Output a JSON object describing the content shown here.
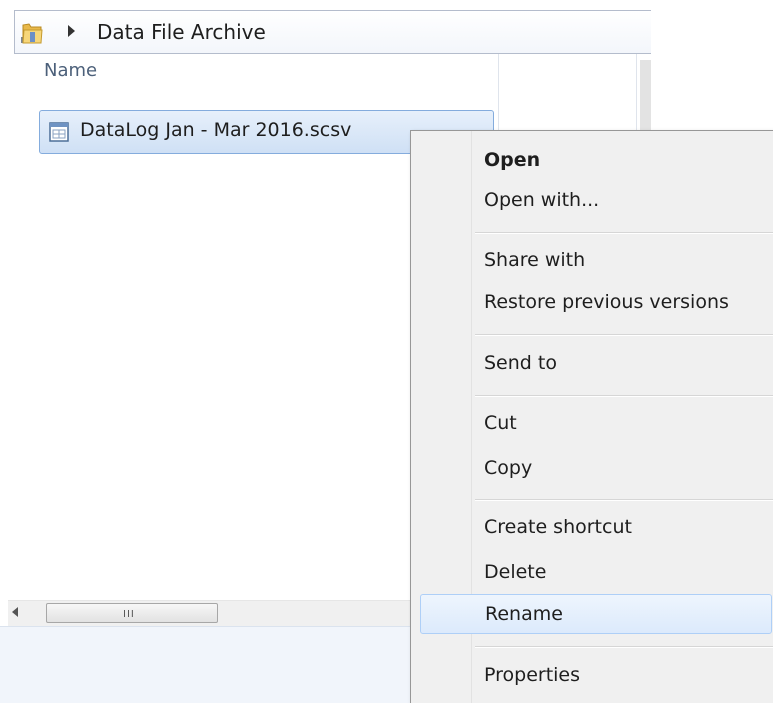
{
  "address_bar": {
    "location": "Data File Archive"
  },
  "column_headers": {
    "name": "Name"
  },
  "files": [
    {
      "name": "DataLog Jan - Mar 2016.scsv",
      "icon": "spreadsheet-file-icon",
      "selected": true
    }
  ],
  "context_menu": {
    "items": [
      {
        "label": "Open",
        "bold": true
      },
      {
        "label": "Open with..."
      },
      {
        "label": "Share with"
      },
      {
        "label": "Restore previous versions"
      },
      {
        "label": "Send to"
      },
      {
        "label": "Cut"
      },
      {
        "label": "Copy"
      },
      {
        "label": "Create shortcut"
      },
      {
        "label": "Delete"
      },
      {
        "label": "Rename",
        "hovered": true
      },
      {
        "label": "Properties"
      }
    ]
  },
  "scrollbar": {
    "grip": "III"
  },
  "colors": {
    "selection_border": "#84acdd",
    "selection_fill": "#cfe0f5",
    "menu_background": "#f0f0f0",
    "hover_border": "#aecff7"
  }
}
